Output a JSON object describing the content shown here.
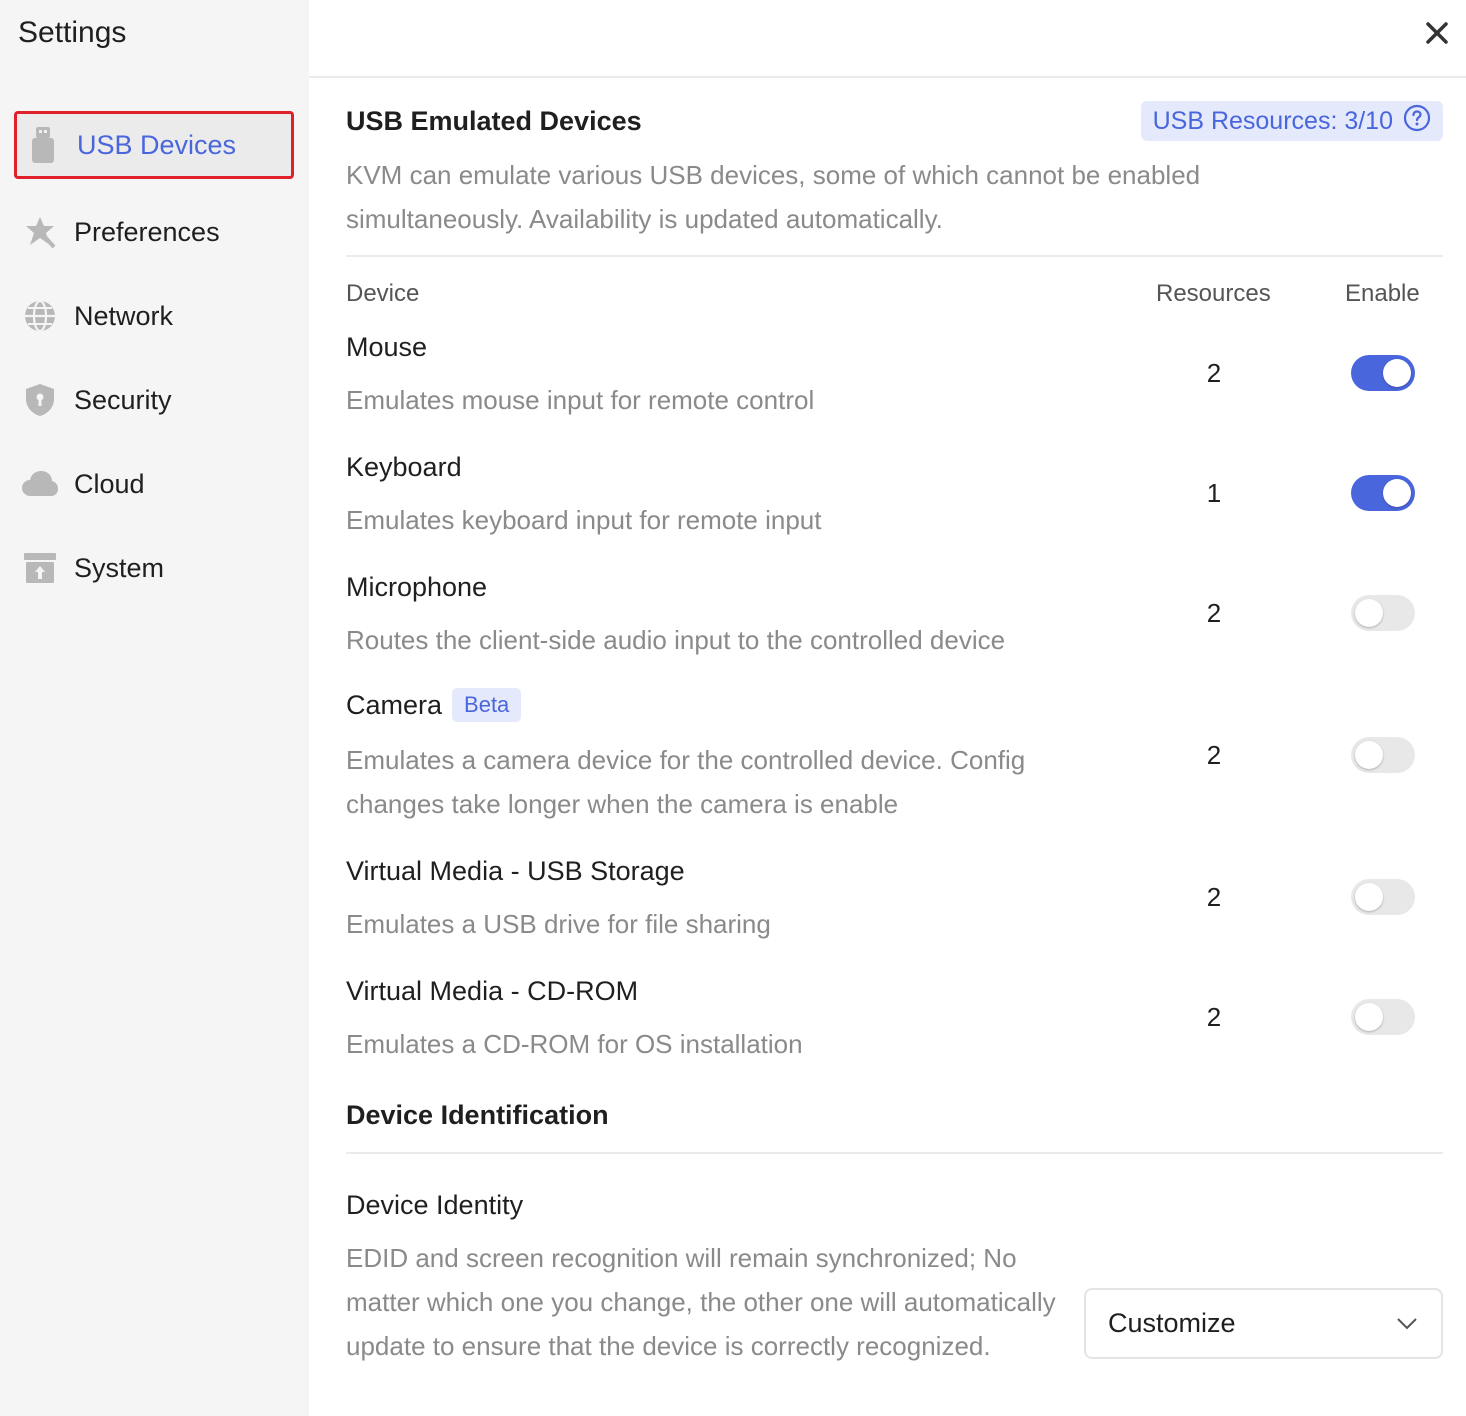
{
  "sidebar": {
    "title": "Settings",
    "items": [
      {
        "label": "USB Devices",
        "icon": "usb-icon",
        "active": true
      },
      {
        "label": "Preferences",
        "icon": "star-badge-icon"
      },
      {
        "label": "Network",
        "icon": "globe-icon"
      },
      {
        "label": "Security",
        "icon": "shield-icon"
      },
      {
        "label": "Cloud",
        "icon": "cloud-icon"
      },
      {
        "label": "System",
        "icon": "upload-box-icon"
      }
    ]
  },
  "header": {
    "close_icon": "close-icon"
  },
  "usb": {
    "title": "USB Emulated Devices",
    "resources_badge": "USB Resources: 3/10",
    "description": "KVM can emulate various USB devices, some of which cannot be enabled simultaneously. Availability is updated automatically.",
    "columns": {
      "device": "Device",
      "resources": "Resources",
      "enable": "Enable"
    },
    "devices": [
      {
        "name": "Mouse",
        "description": "Emulates mouse input for remote control",
        "resources": "2",
        "enabled": true
      },
      {
        "name": "Keyboard",
        "description": "Emulates keyboard input for remote input",
        "resources": "1",
        "enabled": true
      },
      {
        "name": "Microphone",
        "description": "Routes the client-side audio input to the controlled device",
        "resources": "2",
        "enabled": false
      },
      {
        "name": "Camera",
        "badge": "Beta",
        "description": "Emulates a camera device for the controlled device. Config changes take longer when the camera is enable",
        "resources": "2",
        "enabled": false
      },
      {
        "name": "Virtual Media - USB Storage",
        "description": "Emulates a USB drive for file sharing",
        "resources": "2",
        "enabled": false
      },
      {
        "name": "Virtual Media - CD-ROM",
        "description": "Emulates a CD-ROM for OS installation",
        "resources": "2",
        "enabled": false
      }
    ]
  },
  "identification": {
    "title": "Device Identification",
    "identity_label": "Device Identity",
    "identity_description": "EDID and screen recognition will remain synchronized; No matter which one you change, the other one will automatically update to ensure that the device is correctly recognized.",
    "select_value": "Customize"
  },
  "colors": {
    "accent": "#4a66dd",
    "highlight_border": "#e0202a"
  }
}
